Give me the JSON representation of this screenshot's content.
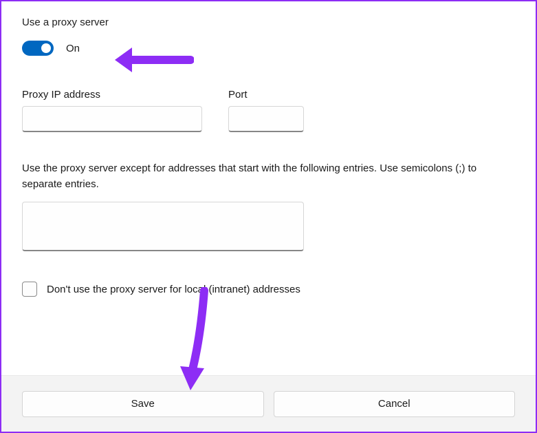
{
  "header": {
    "title": "Use a proxy server"
  },
  "toggle": {
    "state_label": "On",
    "is_on": true
  },
  "fields": {
    "ip": {
      "label": "Proxy IP address",
      "value": ""
    },
    "port": {
      "label": "Port",
      "value": ""
    }
  },
  "exceptions": {
    "description": "Use the proxy server except for addresses that start with the following entries. Use semicolons (;) to separate entries.",
    "value": ""
  },
  "local": {
    "label": "Don't use the proxy server for local (intranet) addresses",
    "checked": false
  },
  "footer": {
    "save_label": "Save",
    "cancel_label": "Cancel"
  },
  "annotation": {
    "arrow_color": "#8d2df5"
  }
}
